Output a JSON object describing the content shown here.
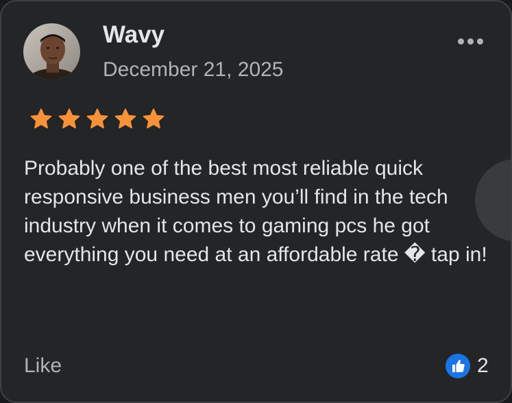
{
  "review": {
    "author": "Wavy",
    "date": "December 21, 2025",
    "rating": 5,
    "rating_max": 5,
    "text": "Probably one of the best most reliable quick responsive business men you’ll find in the tech industry when it comes to gaming pcs he got everything you need at an affordable rate � tap in!",
    "like_label": "Like",
    "like_count": "2"
  },
  "icons": {
    "more": "more-options-icon",
    "star": "star-icon",
    "like": "thumbs-up-icon"
  },
  "colors": {
    "card_background": "#242526",
    "primary_text": "#e4e6eb",
    "secondary_text": "#b0b3b8",
    "star": "#f7923a",
    "like_blue": "#1b74e4"
  }
}
